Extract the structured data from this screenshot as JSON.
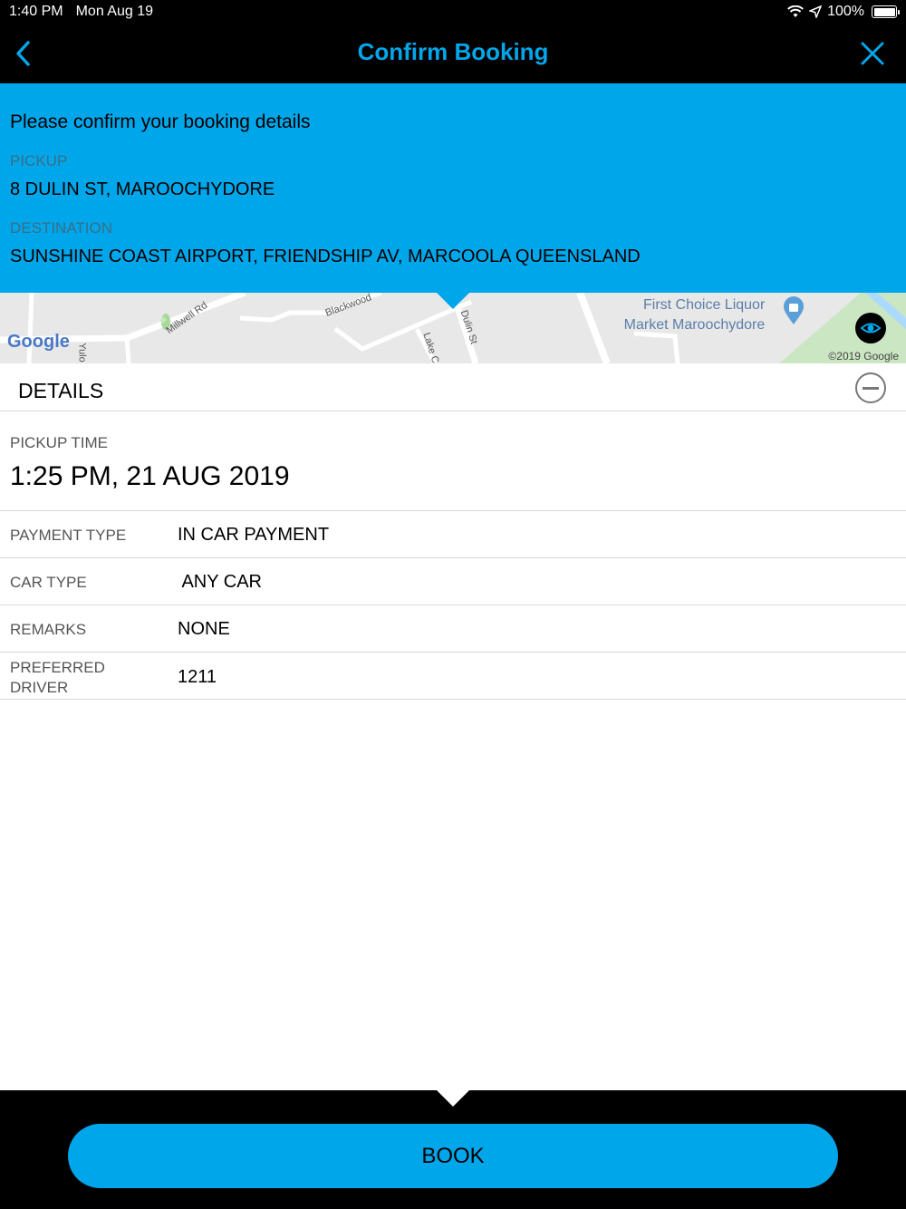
{
  "status_bar": {
    "time": "1:40 PM",
    "date": "Mon Aug 19",
    "battery": "100%"
  },
  "nav": {
    "title": "Confirm Booking",
    "back_icon": "chevron-left-icon",
    "close_icon": "close-icon"
  },
  "confirm": {
    "heading": "Please confirm your booking details",
    "pickup_label": "PICKUP",
    "pickup_value": "8 DULIN ST, MAROOCHYDORE",
    "destination_label": "DESTINATION",
    "destination_value": "SUNSHINE COAST AIRPORT, FRIENDSHIP AV, MARCOOLA  QUEENSLAND"
  },
  "map": {
    "streets": [
      "Millwell Rd",
      "Blackwood",
      "Dulin St",
      "Lake C",
      "Yulo"
    ],
    "poi_line1": "First Choice Liquor",
    "poi_line2": "Market Maroochydore",
    "google_logo": "Google",
    "copyright": "©2019 Google"
  },
  "details": {
    "title": "DETAILS",
    "pickup_time_label": "PICKUP TIME",
    "pickup_time_value": "1:25 PM, 21 AUG 2019",
    "rows": [
      {
        "label": "PAYMENT TYPE",
        "value": "IN CAR PAYMENT"
      },
      {
        "label": "CAR TYPE",
        "value": " ANY CAR"
      },
      {
        "label": "REMARKS",
        "value": "NONE"
      },
      {
        "label": "PREFERRED DRIVER",
        "value": "1211"
      }
    ]
  },
  "book_label": "BOOK",
  "colors": {
    "accent": "#00a6ea",
    "bar": "#000000"
  }
}
